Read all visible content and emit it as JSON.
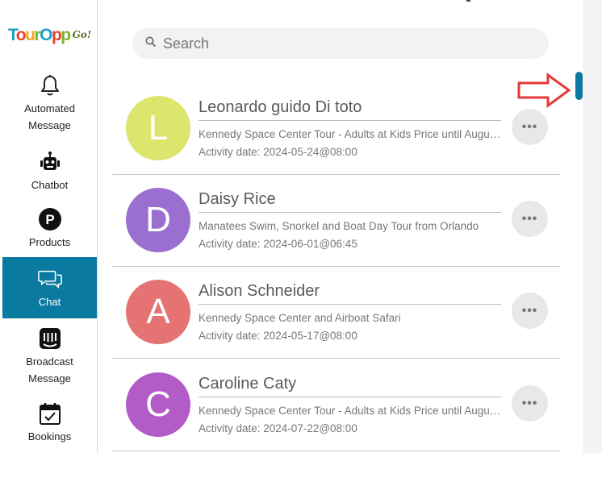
{
  "logo": {
    "word": "TourOpp",
    "go": "Go!",
    "letter_colors": [
      "#1aa0c8",
      "#e8402b",
      "#f4a623",
      "#7bb32e",
      "#1aa0c8",
      "#e8402b",
      "#7bb32e"
    ]
  },
  "sidebar": {
    "items": [
      {
        "label_line1": "Automated",
        "label_line2": "Message",
        "icon": "bell-icon"
      },
      {
        "label_line1": "Chatbot",
        "label_line2": "",
        "icon": "robot-icon"
      },
      {
        "label_line1": "Products",
        "label_line2": "",
        "icon": "products-p-icon"
      },
      {
        "label_line1": "Chat",
        "label_line2": "",
        "icon": "chat-bubbles-icon",
        "active": true
      },
      {
        "label_line1": "Broadcast",
        "label_line2": "Message",
        "icon": "broadcast-icon"
      },
      {
        "label_line1": "Bookings",
        "label_line2": "",
        "icon": "calendar-check-icon"
      }
    ]
  },
  "search": {
    "placeholder": "Search",
    "value": ""
  },
  "conversations": [
    {
      "initial": "L",
      "name": "Leonardo guido Di toto",
      "tour": "Kennedy Space Center Tour - Adults at Kids Price until Augus...",
      "date": "Activity date: 2024-05-24@08:00",
      "color": "#dce56c"
    },
    {
      "initial": "D",
      "name": "Daisy Rice",
      "tour": "Manatees Swim, Snorkel and Boat Day Tour from Orlando",
      "date": "Activity date: 2024-06-01@06:45",
      "color": "#9a6fd0"
    },
    {
      "initial": "A",
      "name": "Alison Schneider",
      "tour": "Kennedy Space Center and Airboat Safari",
      "date": "Activity date: 2024-05-17@08:00",
      "color": "#e57373"
    },
    {
      "initial": "C",
      "name": "Caroline Caty",
      "tour": "Kennedy Space Center Tour - Adults at Kids Price until Augus...",
      "date": "Activity date: 2024-07-22@08:00",
      "color": "#b35cc8"
    }
  ],
  "more_label": "•••",
  "colors": {
    "accent": "#0b7aa1",
    "arrow": "#e53935"
  }
}
